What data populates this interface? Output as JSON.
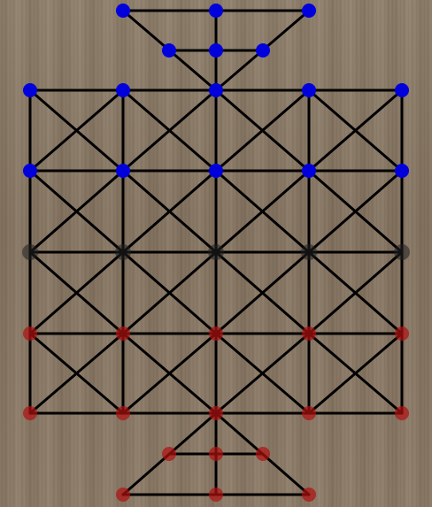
{
  "game": {
    "colors": {
      "board_wood": "#8a7a66",
      "lines": "#000000",
      "player_top": "#0000dd",
      "player_bottom": "#b01010",
      "empty_point": "#202020"
    },
    "players": [
      {
        "side": "top",
        "color": "#0000dd",
        "piece_count": 16
      },
      {
        "side": "bottom",
        "color": "#b01010",
        "piece_count": 16
      }
    ],
    "grid": {
      "columns": 5,
      "rows": 5,
      "triangle_points_per_side": 6
    }
  }
}
